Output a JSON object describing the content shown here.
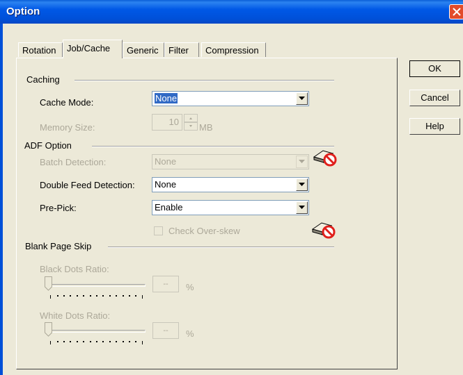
{
  "window": {
    "title": "Option"
  },
  "tabs": [
    {
      "label": "Rotation"
    },
    {
      "label": "Job/Cache",
      "active": true
    },
    {
      "label": "Generic"
    },
    {
      "label": "Filter"
    },
    {
      "label": "Compression"
    }
  ],
  "buttons": {
    "ok": "OK",
    "cancel": "Cancel",
    "help": "Help"
  },
  "caching": {
    "group_label": "Caching",
    "cache_mode_label": "Cache Mode:",
    "cache_mode_value": "None",
    "memory_size_label": "Memory Size:",
    "memory_size_value": "10",
    "memory_unit": "MB"
  },
  "adf": {
    "group_label": "ADF Option",
    "batch_detection_label": "Batch Detection:",
    "batch_detection_value": "None",
    "double_feed_label": "Double Feed Detection:",
    "double_feed_value": "None",
    "pre_pick_label": "Pre-Pick:",
    "pre_pick_value": "Enable",
    "check_overskew_label": "Check Over-skew"
  },
  "blank_page": {
    "group_label": "Blank Page Skip",
    "black_dots_label": "Black Dots Ratio:",
    "black_dots_value": "--",
    "white_dots_label": "White Dots Ratio:",
    "white_dots_value": "--",
    "percent": "%"
  },
  "icons": {
    "no_scanner": "scanner-prohibited-icon",
    "dropdown": "chevron-down-icon",
    "close": "close-icon"
  },
  "colors": {
    "titlebar": "#0058E6",
    "face": "#ECE9D8",
    "selection": "#316AC5",
    "disabled_text": "#ACA899"
  }
}
